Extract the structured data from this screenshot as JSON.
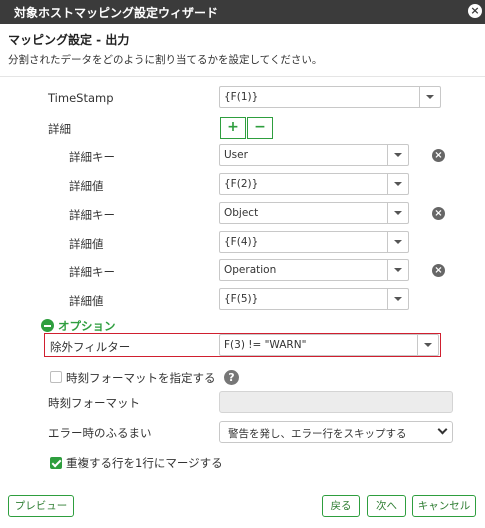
{
  "window": {
    "title": "対象ホストマッピング設定ウィザード",
    "close_glyph": "×"
  },
  "header": {
    "heading": "マッピング設定 - 出力",
    "description": "分割されたデータをどのように割り当てるかを設定してください。"
  },
  "form": {
    "timestamp": {
      "label": "TimeStamp",
      "value": "{F(1)}"
    },
    "details": {
      "label": "詳細",
      "add_glyph": "+",
      "remove_glyph": "−",
      "rows": [
        {
          "key_label": "詳細キー",
          "key_value": "User",
          "value_label": "詳細値",
          "value_value": "{F(2)}"
        },
        {
          "key_label": "詳細キー",
          "key_value": "Object",
          "value_label": "詳細値",
          "value_value": "{F(4)}"
        },
        {
          "key_label": "詳細キー",
          "key_value": "Operation",
          "value_label": "詳細値",
          "value_value": "{F(5)}"
        }
      ],
      "delete_glyph": "×"
    }
  },
  "options": {
    "title": "オプション",
    "exclude_filter": {
      "label": "除外フィルター",
      "value": "F(3) != \"WARN\""
    },
    "specify_time_format": {
      "label": "時刻フォーマットを指定する",
      "checked": false,
      "help_glyph": "?"
    },
    "time_format": {
      "label": "時刻フォーマット",
      "value": ""
    },
    "error_behavior": {
      "label": "エラー時のふるまい",
      "selected": "警告を発し、エラー行をスキップする"
    },
    "merge_duplicates": {
      "label": "重複する行を1行にマージする",
      "checked": true
    }
  },
  "footer": {
    "preview": "プレビュー",
    "back": "戻る",
    "next": "次へ",
    "cancel": "キャンセル"
  },
  "colors": {
    "accent": "#2e9e3e",
    "titlebar": "#3b3b3b",
    "highlight_border": "#d01f2f"
  }
}
